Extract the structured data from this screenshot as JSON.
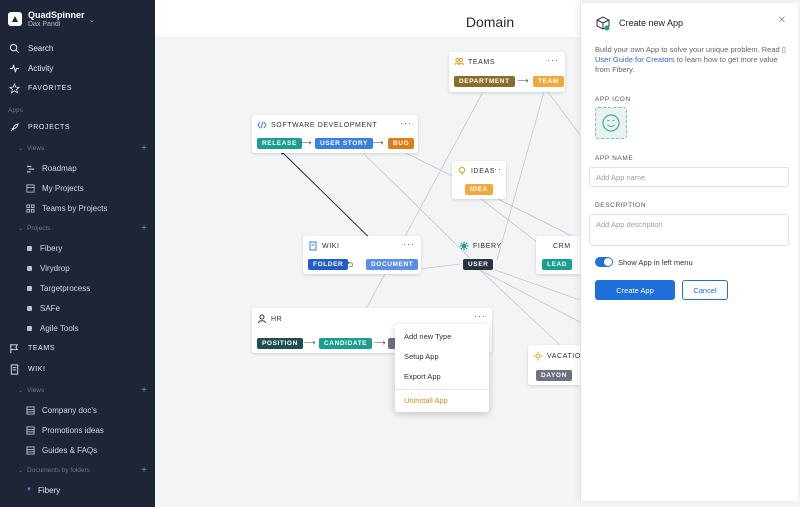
{
  "workspace": {
    "name": "QuadSpinner",
    "user": "Dax Pandi"
  },
  "sidebar": {
    "search": "Search",
    "activity": "Activity",
    "favorites": "FAVORITES",
    "apps_label": "Apps",
    "projects": "PROJECTS",
    "projects_views_header": "Views",
    "projects_views": [
      "Roadmap",
      "My Projects",
      "Teams by Projects"
    ],
    "projects_header": "Projects",
    "projects_items": [
      "Fibery",
      "Virydrop",
      "Targetprocess",
      "SAFe",
      "Agile Tools"
    ],
    "teams": "TEAMS",
    "wiki": "WIKI",
    "wiki_views_header": "Views",
    "wiki_views": [
      "Company doc's",
      "Promotions ideas",
      "Guides & FAQs"
    ],
    "documents_header": "Documents by folders",
    "documents_items": [
      "Fibery"
    ]
  },
  "canvas": {
    "title": "Domain",
    "apps": {
      "teams": {
        "name": "TEAMS",
        "tags": [
          "DEPARTMENT",
          "TEAM"
        ]
      },
      "software": {
        "name": "SOFTWARE DEVELOPMENT",
        "tags": [
          "RELEASE",
          "USER STORY",
          "BUG"
        ]
      },
      "ideas": {
        "name": "IDEAS",
        "tags": [
          "IDEA"
        ]
      },
      "wiki": {
        "name": "WIKI",
        "tags": [
          "FOLDER",
          "DOCUMENT"
        ]
      },
      "fibery": {
        "name": "FIBERY",
        "tags": [
          "USER"
        ]
      },
      "crm": {
        "name": "CRM",
        "tags": [
          "LEAD"
        ]
      },
      "hr": {
        "name": "HR",
        "tags": [
          "POSITION",
          "CANDIDATE"
        ]
      },
      "vacation": {
        "name": "VACATION",
        "tags": [
          "DAYON"
        ]
      }
    },
    "context_menu": [
      "Add new Type",
      "Setup App",
      "Export App",
      "Uninstall App"
    ]
  },
  "panel": {
    "title": "Create new App",
    "description_pre": "Build your own App to solve your unique problem. Read ",
    "description_link": "User Guide for Creators",
    "description_post": " to learn how to get more value from Fibery.",
    "app_icon_label": "APP ICON",
    "app_name_label": "APP NAME",
    "app_name_placeholder": "Add App name",
    "description_label": "DESCRIPTION",
    "description_placeholder": "Add App description",
    "toggle_label": "Show App in left menu",
    "toggle_on": true,
    "create_button": "Create App",
    "cancel_button": "Cancel"
  },
  "colors": {
    "sidebar_bg": "#1d2536",
    "accent": "#1f6fd9",
    "tag_teal": "#1b9e8d",
    "tag_blue": "#3c7fe0",
    "tag_orange": "#e07b1a",
    "tag_amber": "#f2a93b",
    "tag_brown": "#8a6d2d",
    "tag_dark": "#2a3241",
    "tag_gray": "#6c737f",
    "danger": "#d98a1c"
  }
}
